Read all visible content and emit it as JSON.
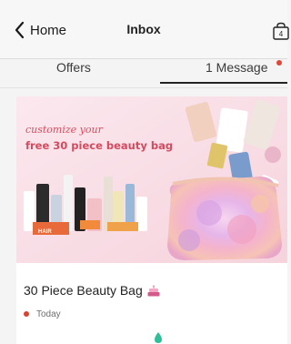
{
  "header": {
    "back_label": "Home",
    "title": "Inbox",
    "bag_count": "4"
  },
  "tabs": {
    "offers_label": "Offers",
    "messages_label": "1 Message",
    "active": "messages"
  },
  "message": {
    "banner": {
      "script_text": "customize your",
      "headline": "free 30 piece beauty bag",
      "product_label": "HAIR"
    },
    "title": "30 Piece Beauty Bag",
    "date": "Today"
  },
  "colors": {
    "accent_red": "#d8432f",
    "banner_pink": "#f6d3dd",
    "promo_text": "#d64a5e",
    "bottom_icon": "#2fbf98"
  }
}
